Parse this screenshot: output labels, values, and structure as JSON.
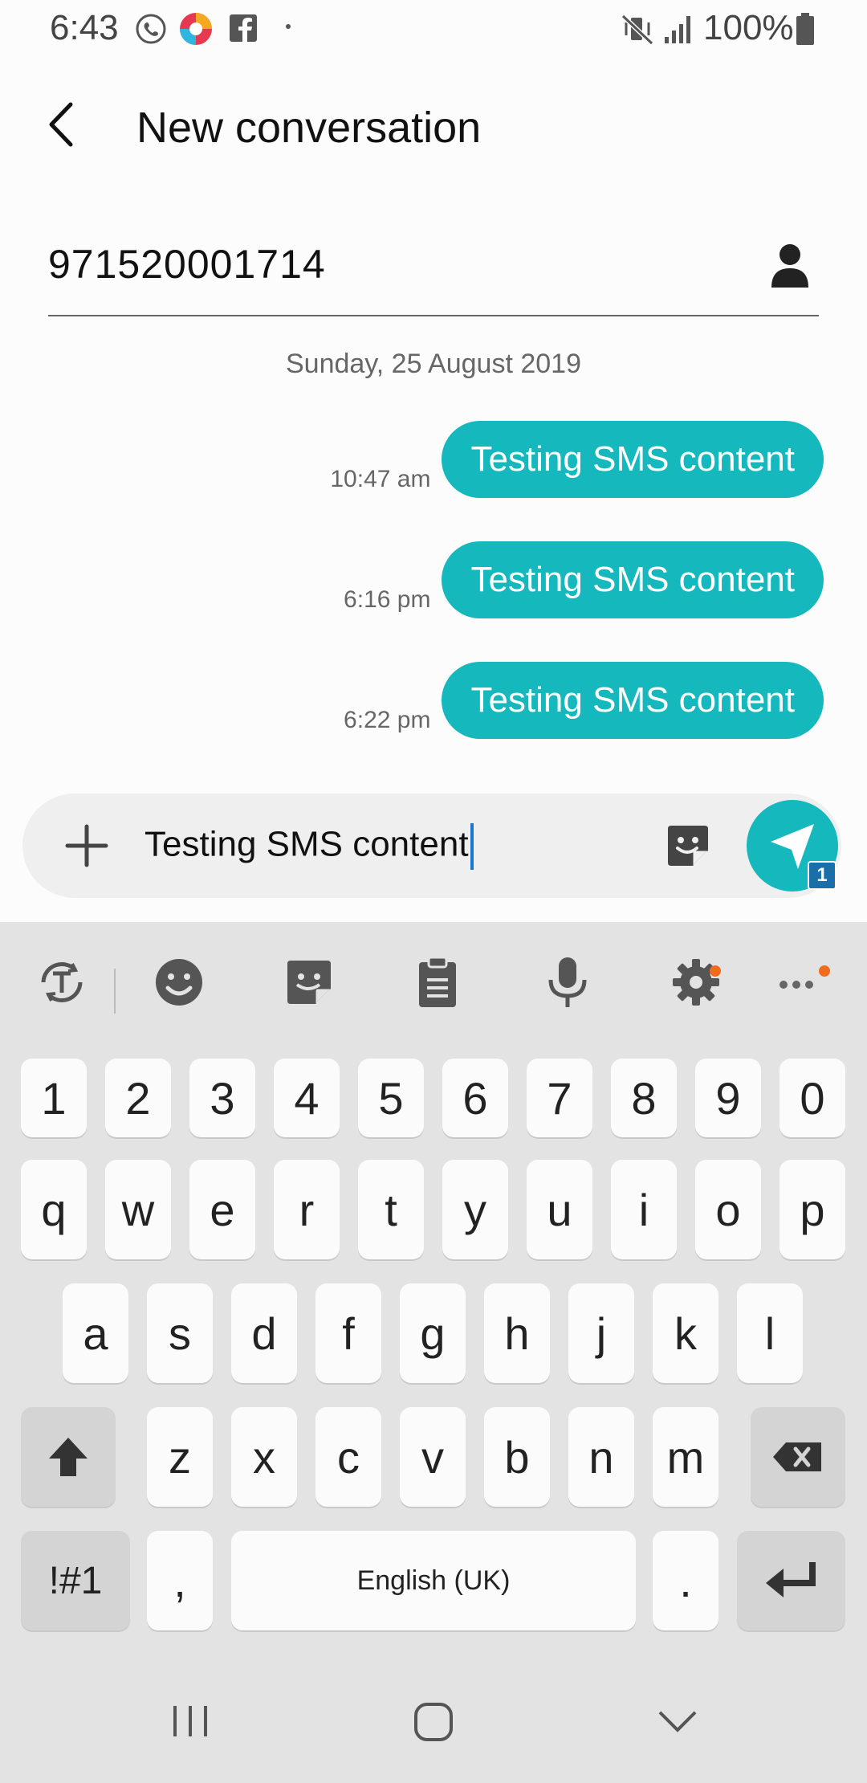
{
  "status_bar": {
    "time": "6:43",
    "battery": "100%",
    "icons_left": [
      "whatsapp-call-icon",
      "chrome-like-app-icon",
      "facebook-icon",
      "dot-icon"
    ],
    "icons_right": [
      "mute-vibrate-icon",
      "signal-icon",
      "battery-icon"
    ]
  },
  "header": {
    "title": "New conversation"
  },
  "recipient": {
    "number": "971520001714"
  },
  "conversation": {
    "date": "Sunday, 25 August 2019",
    "messages": [
      {
        "text": "Testing SMS content",
        "time": "10:47 am"
      },
      {
        "text": "Testing SMS content",
        "time": "6:16 pm"
      },
      {
        "text": "Testing SMS content",
        "time": "6:22 pm"
      }
    ]
  },
  "composer": {
    "value": "Testing SMS content",
    "send_badge": "1"
  },
  "keyboard": {
    "row_numbers": [
      "1",
      "2",
      "3",
      "4",
      "5",
      "6",
      "7",
      "8",
      "9",
      "0"
    ],
    "row_q": [
      "q",
      "w",
      "e",
      "r",
      "t",
      "y",
      "u",
      "i",
      "o",
      "p"
    ],
    "row_a": [
      "a",
      "s",
      "d",
      "f",
      "g",
      "h",
      "j",
      "k",
      "l"
    ],
    "row_z": [
      "z",
      "x",
      "c",
      "v",
      "b",
      "n",
      "m"
    ],
    "symbols_label": "!#1",
    "comma_label": ",",
    "space_label": "English (UK)",
    "period_label": ".",
    "accent_color": "#15b8bc"
  }
}
